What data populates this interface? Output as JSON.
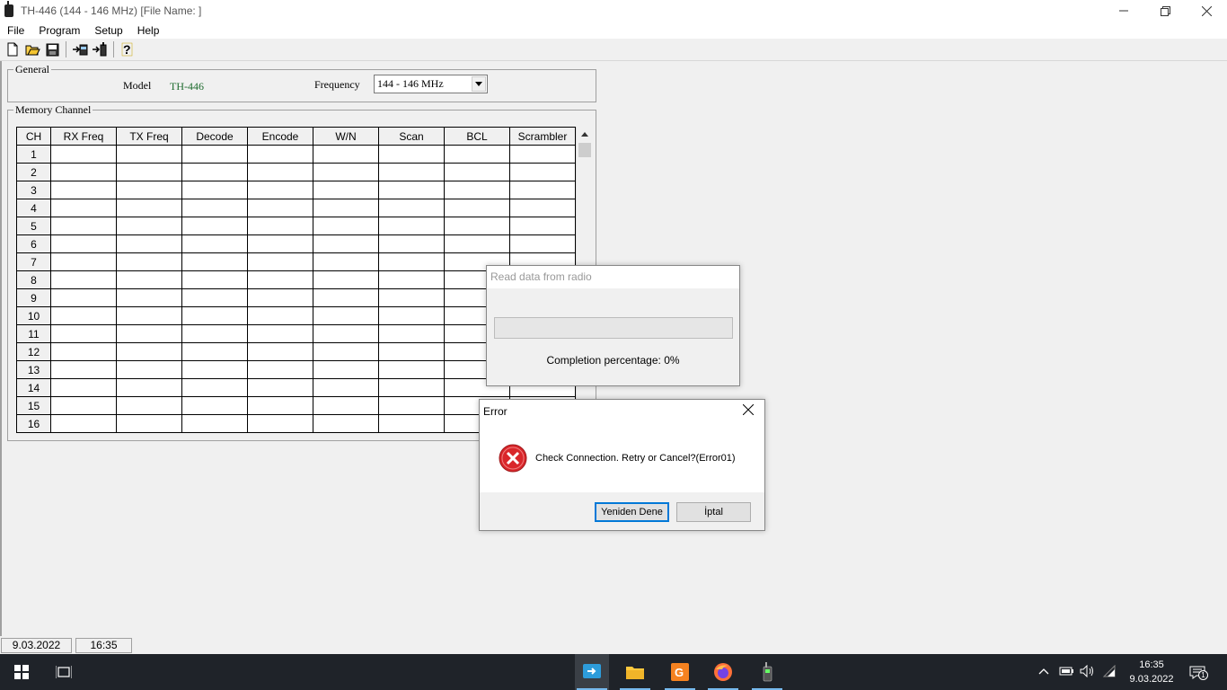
{
  "window": {
    "title": "TH-446 (144 - 146 MHz) [File Name: ]"
  },
  "menu": {
    "items": [
      "File",
      "Program",
      "Setup",
      "Help"
    ]
  },
  "toolbar": {
    "buttons": [
      "new-file-icon",
      "open-folder-icon",
      "save-icon",
      "read-radio-icon",
      "write-radio-icon",
      "help-icon"
    ]
  },
  "general": {
    "legend": "General",
    "model_label": "Model",
    "model_value": "TH-446",
    "frequency_label": "Frequency",
    "frequency_value": "144 - 146 MHz"
  },
  "memory": {
    "legend": "Memory Channel",
    "columns": [
      "CH",
      "RX Freq",
      "TX Freq",
      "Decode",
      "Encode",
      "W/N",
      "Scan",
      "BCL",
      "Scrambler"
    ],
    "rows": [
      "1",
      "2",
      "3",
      "4",
      "5",
      "6",
      "7",
      "8",
      "9",
      "10",
      "11",
      "12",
      "13",
      "14",
      "15",
      "16"
    ]
  },
  "read_dialog": {
    "title": "Read data from radio",
    "progress": 0,
    "completion_text": "Completion percentage:  0%"
  },
  "error_dialog": {
    "title": "Error",
    "message": "Check Connection. Retry or Cancel?(Error01)",
    "retry_label": "Yeniden Dene",
    "cancel_label": "İptal"
  },
  "status": {
    "date": "9.03.2022",
    "time": "16:35"
  },
  "taskbar": {
    "clock_time": "16:35",
    "clock_date": "9.03.2022",
    "notification_count": "1"
  },
  "colors": {
    "model_value": "#1e6b2e",
    "error_icon": "#d9262a",
    "taskbar": "#1f2329",
    "active_underline": "#76b9ed"
  }
}
